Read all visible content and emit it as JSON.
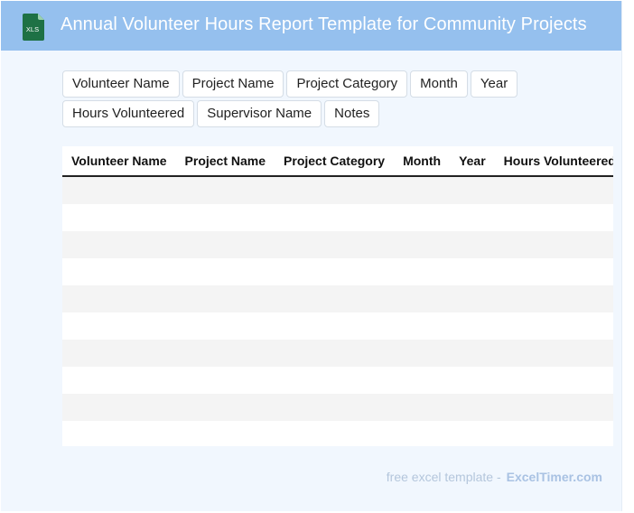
{
  "header": {
    "icon": "xls-file-icon",
    "icon_text": "XLS",
    "icon_color": "#1e7145",
    "title": "Annual Volunteer Hours Report Template for Community Projects",
    "background": "#95c0ee"
  },
  "fields": [
    "Volunteer Name",
    "Project Name",
    "Project Category",
    "Month",
    "Year",
    "Hours Volunteered",
    "Supervisor Name",
    "Notes"
  ],
  "table": {
    "columns": [
      "Volunteer Name",
      "Project Name",
      "Project Category",
      "Month",
      "Year",
      "Hours Volunteered",
      "Supervisor Name",
      "Notes"
    ],
    "row_count": 10
  },
  "footer": {
    "prefix": "free excel template -",
    "brand": "ExcelTimer.com"
  }
}
